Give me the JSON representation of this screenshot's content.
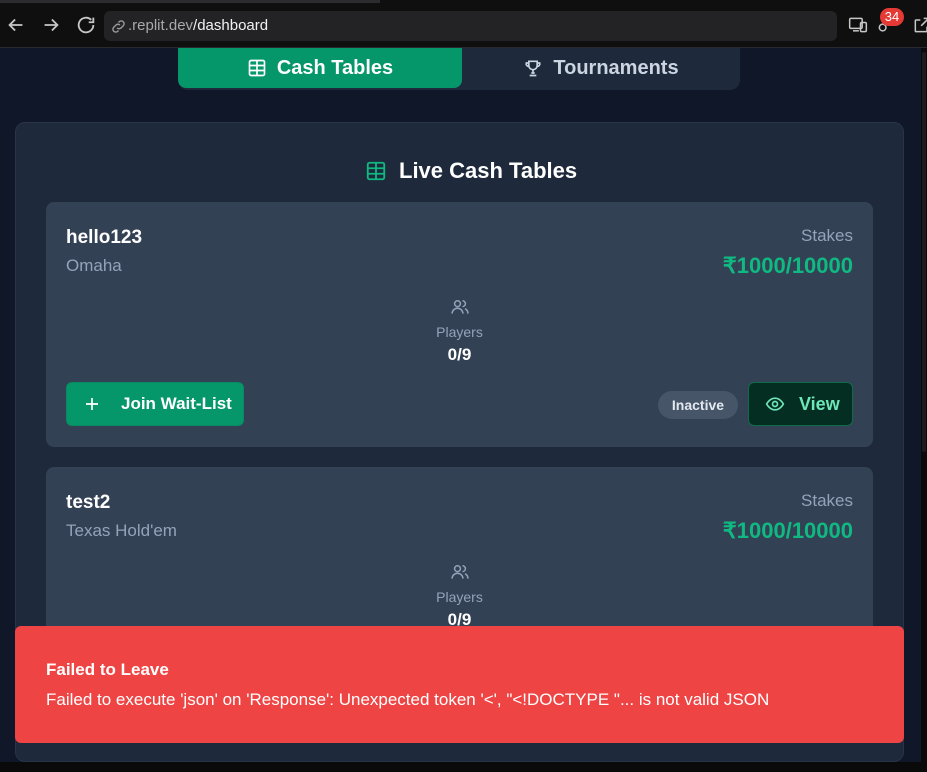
{
  "browser": {
    "url_prefix": ".replit.dev",
    "url_path": "/dashboard",
    "extensions_badge": "34"
  },
  "tabs": [
    {
      "label": "Cash Tables",
      "active": true,
      "icon": "table-icon"
    },
    {
      "label": "Tournaments",
      "active": false,
      "icon": "trophy-icon"
    }
  ],
  "panel": {
    "title": "Live Cash Tables",
    "icon": "table-icon"
  },
  "tables": [
    {
      "name": "hello123",
      "game": "Omaha",
      "stakes_label": "Stakes",
      "stakes": "₹1000/10000",
      "players_label": "Players",
      "players": "0/9",
      "join_label": "Join Wait-List",
      "status": "Inactive",
      "view_label": "View"
    },
    {
      "name": "test2",
      "game": "Texas Hold'em",
      "stakes_label": "Stakes",
      "stakes": "₹1000/10000",
      "players_label": "Players",
      "players": "0/9"
    }
  ],
  "toast": {
    "title": "Failed to Leave",
    "description": "Failed to execute 'json' on 'Response': Unexpected token '<', \"<!DOCTYPE \"... is not valid JSON",
    "color": "#ef4444"
  },
  "colors": {
    "accent": "#059669",
    "stakes": "#10b981",
    "background": "#0f1729",
    "card": "#334155"
  }
}
